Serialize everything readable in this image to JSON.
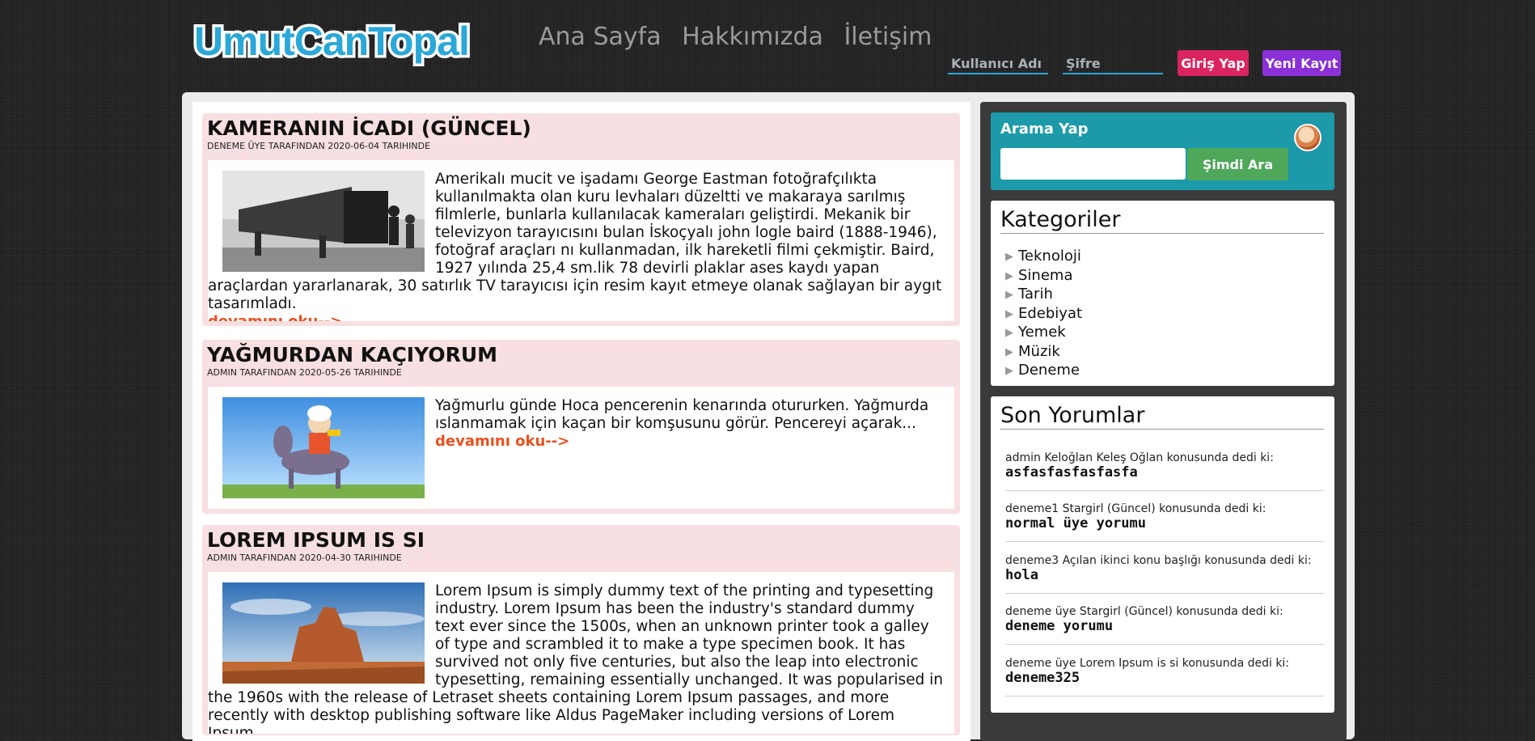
{
  "header": {
    "logo_text": "UmutCanTopal",
    "nav": [
      "Ana Sayfa",
      "Hakkımızda",
      "İletişim"
    ],
    "username_placeholder": "Kullanıcı Adı",
    "password_placeholder": "Şifre",
    "login_label": "Giriş Yap",
    "register_label": "Yeni Kayıt"
  },
  "posts": [
    {
      "title": "KAMERANIN İCADI (GÜNCEL)",
      "meta": "DENEME ÜYE TARAFINDAN 2020-06-04 TARIHINDE",
      "image": "camera-photo",
      "text": "Amerikalı mucit ve işadamı George Eastman fotoğrafçılıkta kullanılmakta olan kuru levhaları düzeltti ve makaraya sarılmış filmlerle, bunlarla kullanılacak kameraları geliştirdi. Mekanik bir televizyon tarayıcısını bulan İskoçyalı john logle baird (1888-1946), fotoğraf araçları nı kullanmadan, ilk hareketli filmi çekmiştir. Baird, 1927 yılında 25,4 sm.lik 78 devirli plaklar ases kaydı yapan araçlardan yararlanarak, 30 satırlık TV tarayıcısı için resim kayıt etmeye olanak sağlayan bir aygıt tasarımladı.",
      "read_more": "devamını oku-->"
    },
    {
      "title": "YAĞMURDAN KAÇIYORUM",
      "meta": "ADMIN TARAFINDAN 2020-05-26 TARIHINDE",
      "image": "nasreddin-hoca-cartoon",
      "text": "Yağmurlu günde Hoca pencerenin kenarında otururken. Yağmurda ıslanmamak için kaçan bir komşusunu görür. Pencereyi açarak...",
      "read_more": "devamını oku-->"
    },
    {
      "title": "LOREM IPSUM IS SI",
      "meta": "ADMIN TARAFINDAN 2020-04-30 TARIHINDE",
      "image": "desert-rock-photo",
      "text": "Lorem Ipsum is simply dummy text of the printing and typesetting industry. Lorem Ipsum has been the industry's standard dummy text ever since the 1500s, when an unknown printer took a galley of type and scrambled it to make a type specimen book. It has survived not only five centuries, but also the leap into electronic typesetting, remaining essentially unchanged. It was popularised in the 1960s with the release of Letraset sheets containing Lorem Ipsum passages, and more recently with desktop publishing software like Aldus PageMaker including versions of Lorem Ipsum.",
      "read_more": ""
    }
  ],
  "sidebar": {
    "search": {
      "title": "Arama Yap",
      "button": "Şimdi Ara"
    },
    "categories": {
      "title": "Kategoriler",
      "items": [
        "Teknoloji",
        "Sinema",
        "Tarih",
        "Edebiyat",
        "Yemek",
        "Müzik",
        "Deneme"
      ]
    },
    "comments": {
      "title": "Son Yorumlar",
      "items": [
        {
          "head": "admin Keloğlan Keleş Oğlan konusunda dedi ki:",
          "body": "asfasfasfasfasfa"
        },
        {
          "head": "deneme1 Stargirl (Güncel) konusunda dedi ki:",
          "body": "normal üye yorumu"
        },
        {
          "head": "deneme3 Açılan ikinci konu başlığı konusunda dedi ki:",
          "body": "hola"
        },
        {
          "head": "deneme üye Stargirl (Güncel) konusunda dedi ki:",
          "body": "deneme yorumu"
        },
        {
          "head": "deneme üye Lorem Ipsum is si konusunda dedi ki:",
          "body": "deneme325"
        }
      ]
    }
  },
  "colors": {
    "accent_blue": "#2aa8d8",
    "login_button": "#d9245f",
    "register_button": "#8b2fd6",
    "read_more": "#e8501e",
    "post_bg": "#f8dfe1",
    "search_box": "#1c9aaa",
    "search_button": "#4fa75a"
  }
}
